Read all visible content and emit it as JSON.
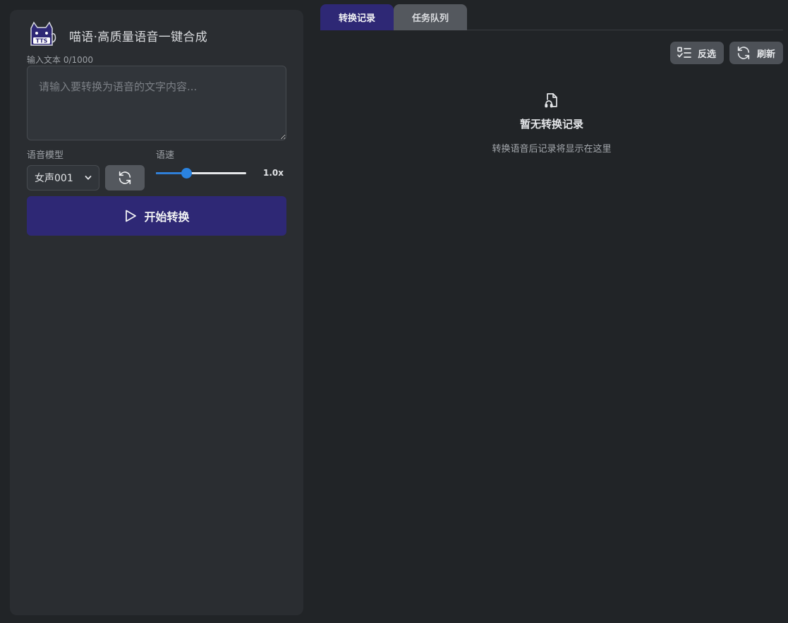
{
  "app": {
    "title": "喵语·高质量语音一键合成",
    "logo_icon": "tts-cat-icon"
  },
  "input": {
    "label": "输入文本 0/1000",
    "placeholder": "请输入要转换为语音的文字内容...",
    "value": ""
  },
  "voice_model": {
    "label": "语音模型",
    "selected": "女声001"
  },
  "speed": {
    "label": "语速",
    "value": 1.0,
    "min": 0.5,
    "max": 2.0,
    "display": "1.0x"
  },
  "start_button": {
    "label": "开始转换",
    "icon": "play-icon"
  },
  "tabs": [
    {
      "label": "转换记录",
      "active": true
    },
    {
      "label": "任务队列",
      "active": false
    }
  ],
  "toolbar": {
    "invert_label": "反选",
    "invert_icon": "checklist-icon",
    "refresh_label": "刷新",
    "refresh_icon": "refresh-icon"
  },
  "empty_state": {
    "icon": "audio-file-icon",
    "title": "暂无转换记录",
    "subtitle": "转换语音后记录将显示在这里"
  },
  "colors": {
    "accent": "#2e2875",
    "slider": "#2a83e0",
    "panel": "#2a2d31",
    "background": "#212427"
  }
}
